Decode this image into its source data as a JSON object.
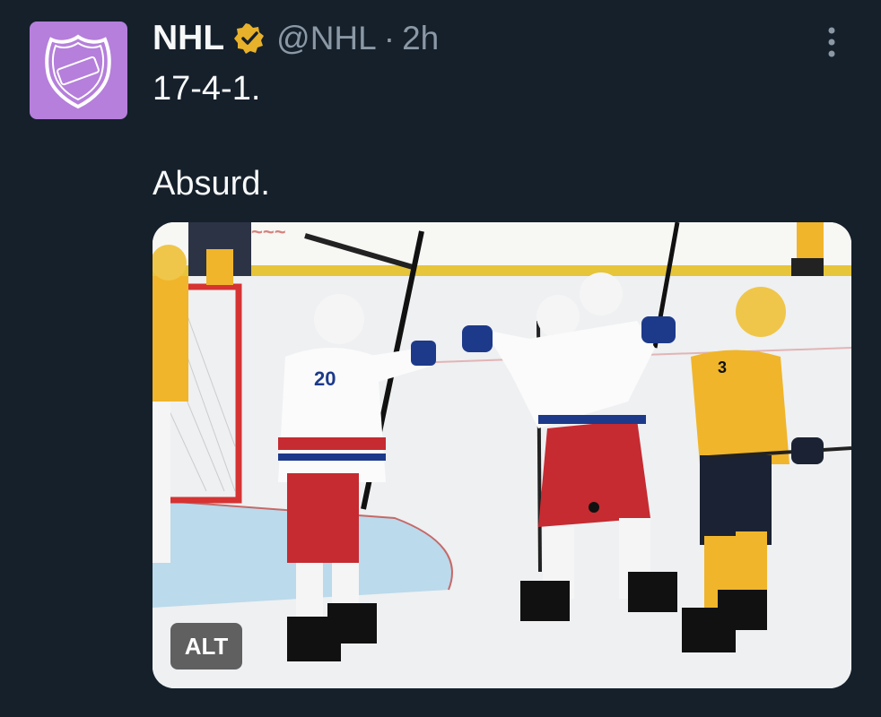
{
  "author": {
    "name": "NHL",
    "handle": "@NHL",
    "separator": "·",
    "time": "2h",
    "avatar_color": "#b57fdb",
    "verified_color": "#e8b12b"
  },
  "tweet": {
    "line1": "17-4-1.",
    "line2": "Absurd."
  },
  "media": {
    "alt_label": "ALT",
    "description_icon": "hockey-celebration-photo"
  },
  "menu_icon": "more-vertical-icon",
  "colors": {
    "background": "#15202b",
    "text": "#f7f9f9",
    "muted": "#8b98a5"
  }
}
